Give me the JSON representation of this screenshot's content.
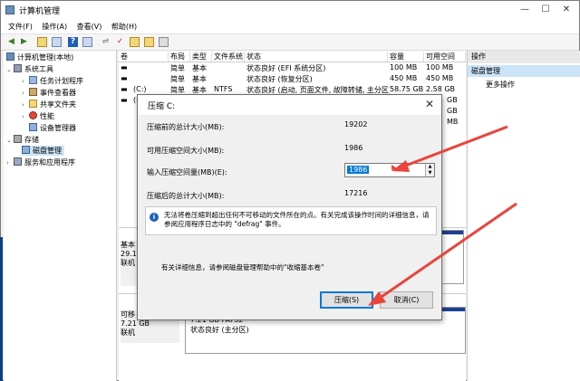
{
  "window": {
    "title": "计算机管理",
    "controls": [
      "—",
      "☐",
      "✕"
    ]
  },
  "menu": [
    "文件(F)",
    "操作(A)",
    "查看(V)",
    "帮助(H)"
  ],
  "tree": {
    "root": "计算机管理(本地)",
    "system_tools": "系统工具",
    "items": [
      "任务计划程序",
      "事件查看器",
      "共享文件夹",
      "性能",
      "设备管理器"
    ],
    "storage": "存储",
    "disk_management": "磁盘管理",
    "services": "服务和应用程序"
  },
  "volume_table": {
    "headers": [
      "卷",
      "布局",
      "类型",
      "文件系统",
      "状态",
      "容量",
      "可用空间"
    ],
    "rows": [
      [
        "",
        "简单",
        "基本",
        "",
        "状态良好 (EFI 系统分区)",
        "100 MB",
        "100 MB"
      ],
      [
        "",
        "简单",
        "基本",
        "",
        "状态良好 (恢复分区)",
        "450 MB",
        "450 MB"
      ],
      [
        "(C:)",
        "简单",
        "基本",
        "NTFS",
        "状态良好 (启动, 页面文件, 故障转储, 主分区)",
        "58.75 GB",
        "2.58 GB"
      ],
      [
        "(D:)",
        "",
        "",
        "",
        "",
        "",
        "GB"
      ],
      [
        "",
        "",
        "",
        "",
        "",
        "",
        "GB"
      ],
      [
        "",
        "",
        "",
        "",
        "",
        "",
        "MB"
      ]
    ]
  },
  "disk_area": {
    "disk0_label": [
      "基本",
      "29.1",
      "联机"
    ],
    "disk1_label": [
      "可移",
      "7.21 GB",
      "联机"
    ],
    "disk1_partition": [
      "7.21 GB FAT32",
      "状态良好 (主分区)"
    ]
  },
  "actions": {
    "header": "操作",
    "selected": "磁盘管理",
    "more": "更多操作"
  },
  "dialog": {
    "title": "压缩 C:",
    "total_before_label": "压缩前的总计大小(MB):",
    "total_before_value": "19202",
    "available_label": "可用压缩空间大小(MB):",
    "available_value": "1986",
    "input_label": "输入压缩空间量(MB)(E):",
    "input_value": "1986",
    "total_after_label": "压缩后的总计大小(MB):",
    "total_after_value": "17216",
    "info_text": "无法将卷压缩到超出任何不可移动的文件所在的点。有关完成该操作时间的详细信息，请参阅应用程序日志中的 \"defrag\" 事件。",
    "more_info": "有关详细信息，请参阅磁盘管理帮助中的\"收缩基本卷\"",
    "compress_button": "压缩(S)",
    "cancel_button": "取消(C)",
    "close_glyph": "✕"
  },
  "colors": {
    "accent": "#0078d7",
    "disk_bar": "#1b3f91",
    "arrow": "#e8453c"
  }
}
